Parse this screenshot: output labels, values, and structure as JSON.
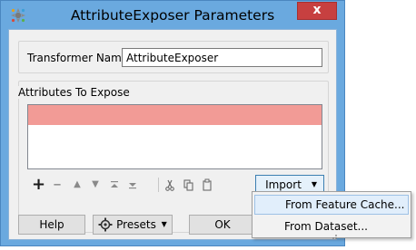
{
  "window": {
    "title": "AttributeExposer Parameters",
    "close_label": "x"
  },
  "transformer_name": {
    "label": "Transformer Name:",
    "value": "AttributeExposer"
  },
  "attributes_group": {
    "label": "Attributes To Expose",
    "rows": [
      ""
    ],
    "row_highlight_color": "#f29b96"
  },
  "toolbar": {
    "icons": [
      "plus-icon",
      "minus-icon",
      "move-up-icon",
      "move-down-icon",
      "move-top-icon",
      "move-bottom-icon",
      "cut-icon",
      "copy-icon",
      "paste-icon"
    ],
    "import_label": "Import"
  },
  "buttons": {
    "help": "Help",
    "presets": "Presets",
    "ok": "OK"
  },
  "import_menu": {
    "items": [
      "From Feature Cache...",
      "From Dataset..."
    ],
    "highlighted_index": 0
  },
  "colors": {
    "frame": "#6aa9df",
    "close": "#c74040",
    "client": "#f0f0f0",
    "menu_highlight": "#e1eefb"
  }
}
